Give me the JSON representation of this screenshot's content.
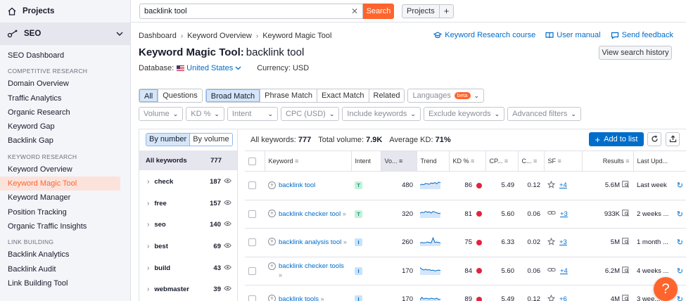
{
  "sidebar": {
    "projects_label": "Projects",
    "seo_label": "SEO",
    "items": [
      {
        "type": "item",
        "label": "SEO Dashboard"
      },
      {
        "type": "section",
        "label": "COMPETITIVE RESEARCH"
      },
      {
        "type": "item",
        "label": "Domain Overview"
      },
      {
        "type": "item",
        "label": "Traffic Analytics"
      },
      {
        "type": "item",
        "label": "Organic Research"
      },
      {
        "type": "item",
        "label": "Keyword Gap"
      },
      {
        "type": "item",
        "label": "Backlink Gap"
      },
      {
        "type": "section",
        "label": "KEYWORD RESEARCH"
      },
      {
        "type": "item",
        "label": "Keyword Overview"
      },
      {
        "type": "item",
        "label": "Keyword Magic Tool",
        "active": true
      },
      {
        "type": "item",
        "label": "Keyword Manager"
      },
      {
        "type": "item",
        "label": "Position Tracking"
      },
      {
        "type": "item",
        "label": "Organic Traffic Insights"
      },
      {
        "type": "section",
        "label": "LINK BUILDING"
      },
      {
        "type": "item",
        "label": "Backlink Analytics"
      },
      {
        "type": "item",
        "label": "Backlink Audit"
      },
      {
        "type": "item",
        "label": "Link Building Tool"
      }
    ]
  },
  "topbar": {
    "search_value": "backlink tool",
    "search_button": "Search",
    "projects_button": "Projects",
    "plus_button": "+"
  },
  "breadcrumb": [
    "Dashboard",
    "Keyword Overview",
    "Keyword Magic Tool"
  ],
  "header_links": {
    "course": "Keyword Research course",
    "manual": "User manual",
    "feedback": "Send feedback"
  },
  "title": {
    "tool": "Keyword Magic Tool:",
    "keyword": "backlink tool",
    "history_button": "View search history"
  },
  "database": {
    "label": "Database:",
    "value": "United States",
    "currency": "Currency: USD"
  },
  "filters": {
    "match_all": "All",
    "match_questions": "Questions",
    "broad": "Broad Match",
    "phrase": "Phrase Match",
    "exact": "Exact Match",
    "related": "Related",
    "languages": "Languages",
    "beta": "beta",
    "volume": "Volume",
    "kd": "KD %",
    "intent": "Intent",
    "cpc": "CPC (USD)",
    "include": "Include keywords",
    "exclude": "Exclude keywords",
    "advanced": "Advanced filters"
  },
  "groups": {
    "by_number": "By number",
    "by_volume": "By volume",
    "all_label": "All keywords",
    "all_count": "777",
    "rows": [
      {
        "name": "check",
        "count": "187"
      },
      {
        "name": "free",
        "count": "157"
      },
      {
        "name": "seo",
        "count": "140"
      },
      {
        "name": "best",
        "count": "69"
      },
      {
        "name": "build",
        "count": "43"
      },
      {
        "name": "webmaster",
        "count": "39"
      }
    ]
  },
  "summary": {
    "all_label": "All keywords:",
    "all_value": "777",
    "volume_label": "Total volume:",
    "volume_value": "7.9K",
    "kd_label": "Average KD:",
    "kd_value": "71%",
    "add_to_list": "Add to list"
  },
  "table": {
    "headers": [
      "Keyword",
      "Intent",
      "Vo...",
      "Trend",
      "KD %",
      "CP...",
      "C...",
      "SF",
      "Results",
      "Last Upd..."
    ],
    "rows": [
      {
        "keyword": "backlink tool",
        "arrow": false,
        "intent": "T",
        "volume": "480",
        "kd": "86",
        "cpc": "5.49",
        "com": "0.12",
        "sf_icon": "star",
        "sf": "+4",
        "results": "5.6M",
        "updated": "Last week",
        "trend": [
          0.4,
          0.5,
          0.45,
          0.6,
          0.55,
          0.5,
          0.65,
          0.6,
          0.7,
          0.55,
          0.75,
          0.7
        ]
      },
      {
        "keyword": "backlink checker tool",
        "arrow": true,
        "intent": "T",
        "volume": "320",
        "kd": "81",
        "cpc": "5.60",
        "com": "0.06",
        "sf_icon": "link",
        "sf": "+3",
        "results": "933K",
        "updated": "2 weeks ...",
        "trend": [
          0.5,
          0.6,
          0.55,
          0.7,
          0.6,
          0.65,
          0.5,
          0.7,
          0.6,
          0.55,
          0.45,
          0.5
        ]
      },
      {
        "keyword": "backlink analysis tool",
        "arrow": true,
        "intent": "I",
        "volume": "260",
        "kd": "75",
        "cpc": "6.33",
        "com": "0.02",
        "sf_icon": "star",
        "sf": "+3",
        "results": "5M",
        "updated": "1 month ...",
        "trend": [
          0.3,
          0.35,
          0.3,
          0.35,
          0.4,
          0.35,
          0.3,
          0.9,
          0.35,
          0.4,
          0.35,
          0.3
        ]
      },
      {
        "keyword": "backlink checker tools",
        "arrow": true,
        "intent": "I",
        "volume": "170",
        "kd": "84",
        "cpc": "5.60",
        "com": "0.06",
        "sf_icon": "link",
        "sf": "+4",
        "results": "6.2M",
        "updated": "4 weeks ...",
        "trend": [
          0.8,
          0.6,
          0.5,
          0.6,
          0.5,
          0.55,
          0.45,
          0.5,
          0.4,
          0.45,
          0.5,
          0.45
        ]
      },
      {
        "keyword": "backlink tools",
        "arrow": true,
        "intent": "I",
        "volume": "170",
        "kd": "89",
        "cpc": "5.49",
        "com": "0.12",
        "sf_icon": "star",
        "sf": "+6",
        "results": "4M",
        "updated": "3 wee...",
        "trend": [
          0.3,
          0.6,
          0.4,
          0.5,
          0.45,
          0.4,
          0.5,
          0.45,
          0.4,
          0.5,
          0.35,
          0.4
        ]
      }
    ]
  },
  "help_label": "?",
  "colors": {
    "accent": "#ff642d",
    "link": "#006dca",
    "kd_dot": "#e1243d",
    "trend": "#006dca"
  }
}
